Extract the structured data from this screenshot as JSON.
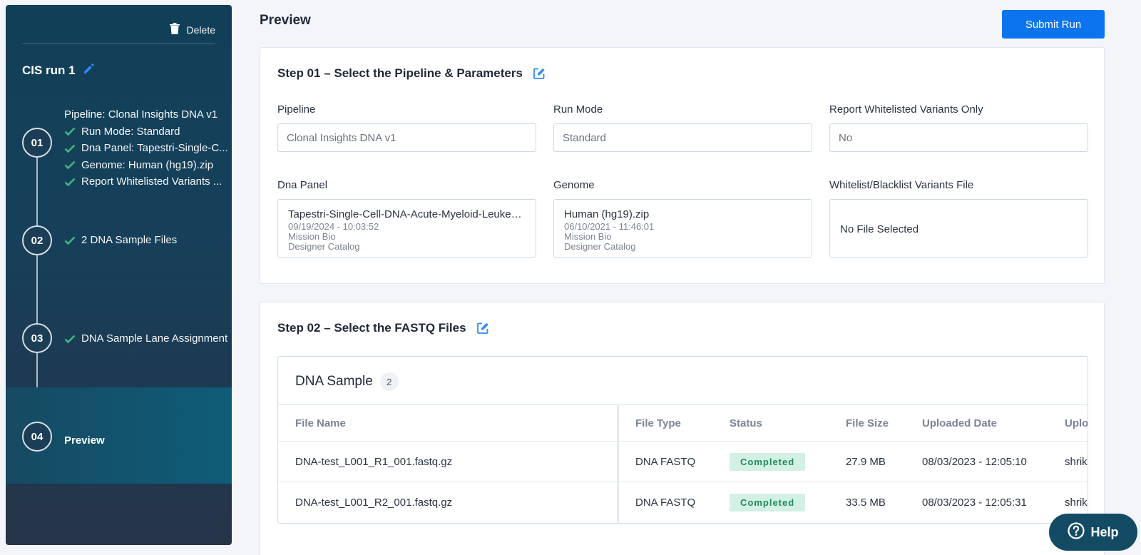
{
  "sidebar": {
    "delete_label": "Delete",
    "run_name": "CIS run 1",
    "steps": [
      {
        "number": "01",
        "lines": [
          "Pipeline: Clonal Insights DNA v1",
          "Run Mode: Standard",
          "Dna Panel: Tapestri-Single-C...",
          "Genome: Human (hg19).zip",
          "Report Whitelisted Variants ..."
        ]
      },
      {
        "number": "02",
        "lines": [
          "2 DNA Sample Files"
        ]
      },
      {
        "number": "03",
        "lines": [
          "DNA Sample Lane Assignment"
        ]
      },
      {
        "number": "04",
        "label": "Preview"
      }
    ]
  },
  "header": {
    "title": "Preview",
    "submit_label": "Submit Run"
  },
  "step1": {
    "title": "Step 01 – Select the Pipeline & Parameters",
    "pipeline": {
      "label": "Pipeline",
      "value": "Clonal Insights DNA v1"
    },
    "run_mode": {
      "label": "Run Mode",
      "value": "Standard"
    },
    "report_whitelisted": {
      "label": "Report Whitelisted Variants Only",
      "value": "No"
    },
    "dna_panel": {
      "label": "Dna Panel",
      "name": "Tapestri-Single-Cell-DNA-Acute-Myeloid-Leukemia",
      "date": "09/19/2024 - 10:03:52",
      "org": "Mission Bio",
      "catalog": "Designer Catalog"
    },
    "genome": {
      "label": "Genome",
      "name": "Human (hg19).zip",
      "date": "06/10/2021 - 11:46:01",
      "org": "Mission Bio",
      "catalog": "Designer Catalog"
    },
    "variants_file": {
      "label": "Whitelist/Blacklist Variants File",
      "value": "No File Selected"
    }
  },
  "step2": {
    "title": "Step 02 – Select the FASTQ Files",
    "panel_title": "DNA Sample",
    "count": "2",
    "columns": [
      "File Name",
      "File Type",
      "Status",
      "File Size",
      "Uploaded Date",
      "Uploaded By"
    ],
    "rows": [
      {
        "file_name": "DNA-test_L001_R1_001.fastq.gz",
        "file_type": "DNA FASTQ",
        "status": "Completed",
        "file_size": "27.9 MB",
        "uploaded_date": "08/03/2023 - 12:05:10",
        "uploaded_by": "shrikant"
      },
      {
        "file_name": "DNA-test_L001_R2_001.fastq.gz",
        "file_type": "DNA FASTQ",
        "status": "Completed",
        "file_size": "33.5 MB",
        "uploaded_date": "08/03/2023 - 12:05:31",
        "uploaded_by": "shrikant"
      }
    ]
  },
  "help": {
    "label": "Help"
  },
  "colors": {
    "accent": "#0d74f0",
    "sidebar": "#123f58",
    "success": "#1f8b5b",
    "check": "#3fb77e"
  },
  "icons": {
    "delete": "trash-icon",
    "edit": "pencil-icon",
    "edit_box": "edit-square-icon",
    "check": "check-icon",
    "help": "question-circle-icon"
  }
}
